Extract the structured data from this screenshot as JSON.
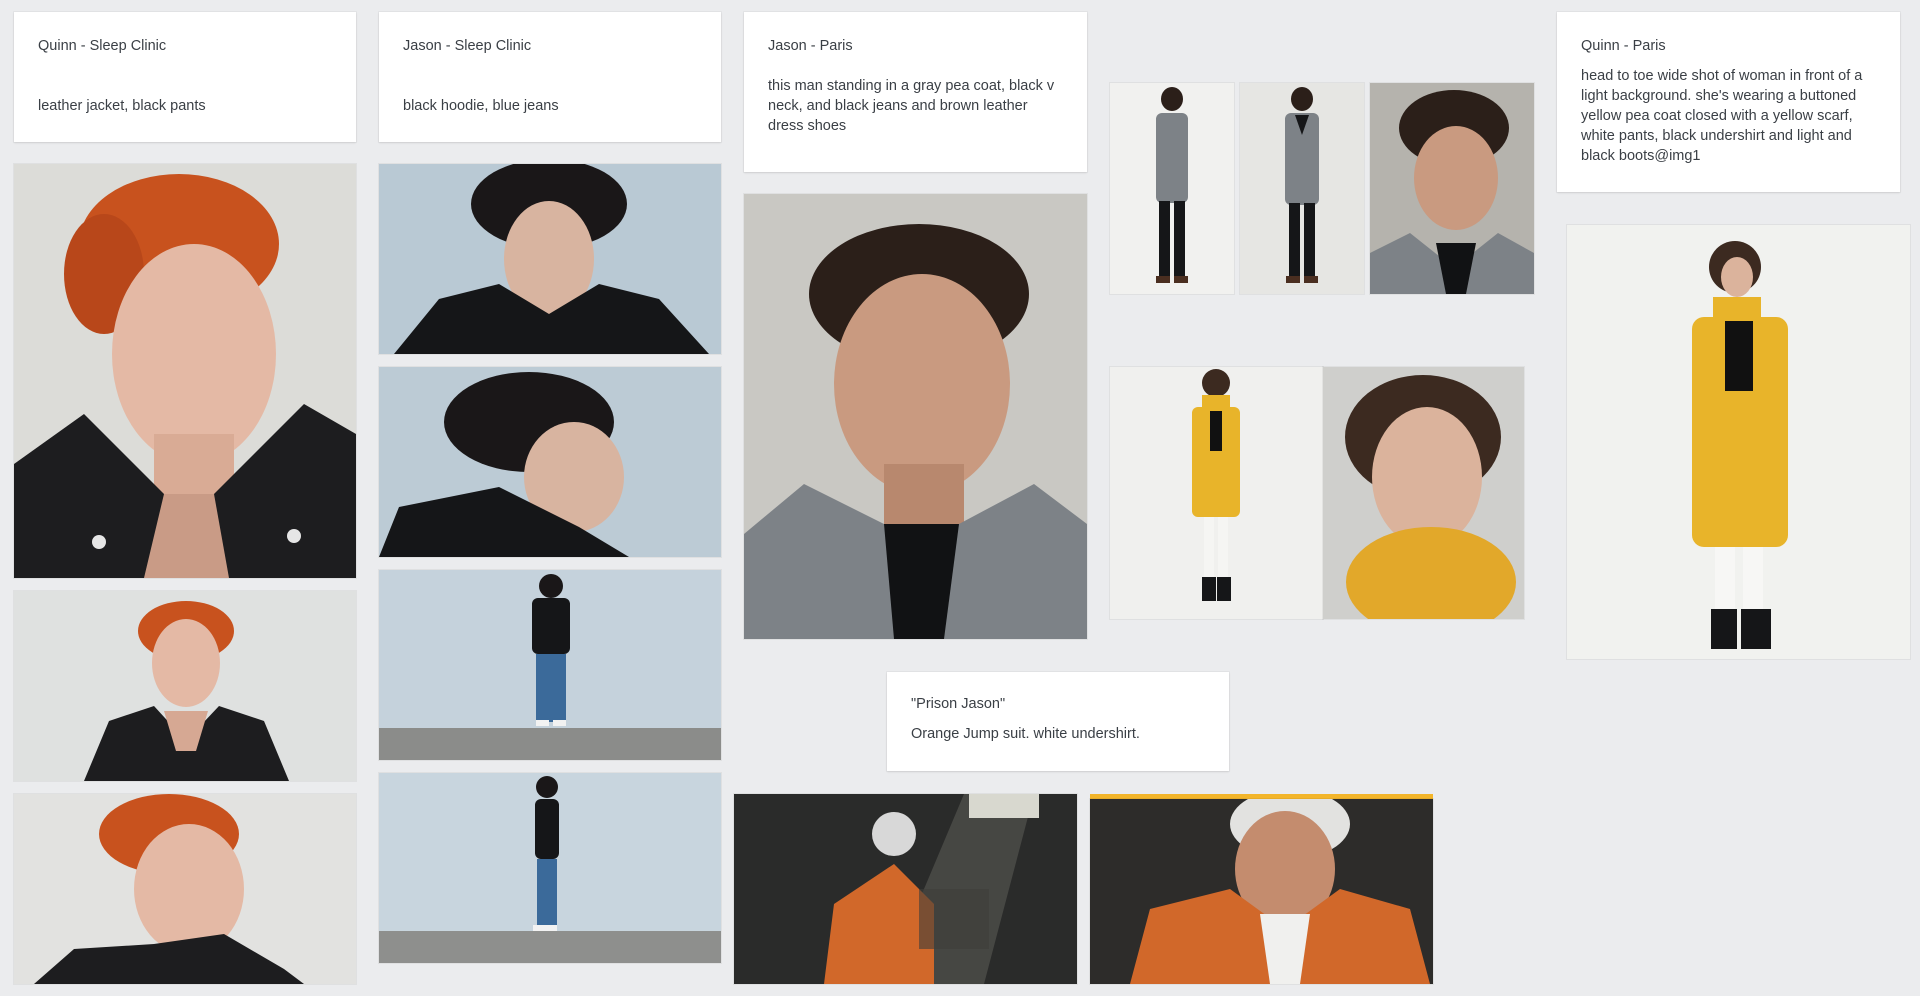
{
  "notes": {
    "quinn_sleep": {
      "title": "Quinn - Sleep Clinic",
      "body": "leather jacket, black pants"
    },
    "jason_sleep": {
      "title": "Jason - Sleep Clinic",
      "body": "black hoodie, blue jeans"
    },
    "jason_paris": {
      "title": "Jason - Paris",
      "body": "this man standing in a gray pea coat, black v neck, and black jeans and brown leather dress shoes"
    },
    "quinn_paris": {
      "title": "Quinn - Paris",
      "body": "head to toe wide shot of woman in front of a light background. she's wearing a buttoned yellow pea coat closed with a yellow scarf, white pants, black undershirt and light and black boots@img1"
    },
    "prison_jason": {
      "title": "\"Prison Jason\"",
      "body": "Orange Jump suit. white undershirt."
    }
  },
  "colors": {
    "canvas": "#ebecee",
    "hair_red": "#c8521e",
    "leather_black": "#1d1d1f",
    "hoodie_black": "#151618",
    "studio_blue": "#b9c9d4",
    "gray_coat": "#7d8287",
    "yellow_coat": "#e8b42a",
    "prison_orange": "#d1682a",
    "selection_accent": "#f3b52a"
  }
}
